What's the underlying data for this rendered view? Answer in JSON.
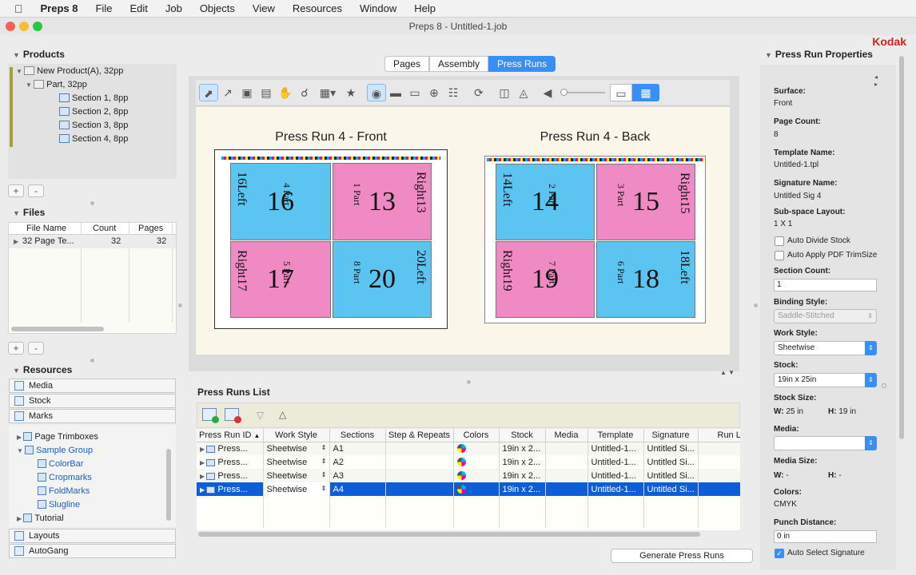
{
  "menubar": {
    "apple_icon": "apple-icon",
    "app": "Preps 8",
    "items": [
      "File",
      "Edit",
      "Job",
      "Objects",
      "View",
      "Resources",
      "Window",
      "Help"
    ]
  },
  "window": {
    "title": "Preps 8 - Untitled-1.job",
    "brand": "Kodak"
  },
  "products": {
    "title": "Products",
    "items": [
      "New Product(A), 32pp",
      "Part, 32pp",
      "Section 1, 8pp",
      "Section 2, 8pp",
      "Section 3, 8pp",
      "Section 4, 8pp"
    ],
    "add": "+",
    "remove": "-"
  },
  "files": {
    "title": "Files",
    "columns": [
      "File Name",
      "Count",
      "Pages"
    ],
    "row": {
      "name": "32 Page Te...",
      "count": "32",
      "pages": "32"
    },
    "add": "+",
    "remove": "-"
  },
  "resources": {
    "title": "Resources",
    "top": [
      "Media",
      "Stock",
      "Marks"
    ],
    "tree": [
      "Page Trimboxes",
      "Sample Group",
      "ColorBar",
      "Cropmarks",
      "FoldMarks",
      "Slugline",
      "Tutorial"
    ],
    "bottom": [
      "Layouts",
      "AutoGang"
    ]
  },
  "tabs": [
    "Pages",
    "Assembly",
    "Press Runs"
  ],
  "active_tab": "Press Runs",
  "sheets": {
    "front": {
      "title": "Press Run 4 - Front",
      "pages": [
        {
          "num": "16",
          "label": "16Left",
          "part": "4 Part",
          "color": "blue"
        },
        {
          "num": "13",
          "label": "Right13",
          "part": "1 Part",
          "color": "pink"
        },
        {
          "num": "17",
          "label": "Right17",
          "part": "5 Part",
          "color": "pink"
        },
        {
          "num": "20",
          "label": "20Left",
          "part": "8 Part",
          "color": "blue"
        }
      ]
    },
    "back": {
      "title": "Press Run 4 - Back",
      "pages": [
        {
          "num": "14",
          "label": "14Left",
          "part": "2 Part",
          "color": "blue"
        },
        {
          "num": "15",
          "label": "Right15",
          "part": "3 Part",
          "color": "pink"
        },
        {
          "num": "19",
          "label": "Right19",
          "part": "7 Part",
          "color": "pink"
        },
        {
          "num": "18",
          "label": "18Left",
          "part": "6 Part",
          "color": "blue"
        }
      ]
    }
  },
  "press_runs": {
    "title": "Press Runs List",
    "columns": [
      "Press Run ID",
      "Work Style",
      "Sections",
      "Step & Repeats",
      "Colors",
      "Stock",
      "Media",
      "Template",
      "Signature",
      "Run L"
    ],
    "rows": [
      {
        "id": "Press...",
        "work": "Sheetwise",
        "sections": "A1",
        "stock": "19in x 2...",
        "template": "Untitled-1...",
        "signature": "Untitled Si..."
      },
      {
        "id": "Press...",
        "work": "Sheetwise",
        "sections": "A2",
        "stock": "19in x 2...",
        "template": "Untitled-1...",
        "signature": "Untitled Si..."
      },
      {
        "id": "Press...",
        "work": "Sheetwise",
        "sections": "A3",
        "stock": "19in x 2...",
        "template": "Untitled-1...",
        "signature": "Untitled Si..."
      },
      {
        "id": "Press...",
        "work": "Sheetwise",
        "sections": "A4",
        "stock": "19in x 2...",
        "template": "Untitled-1...",
        "signature": "Untitled Si..."
      }
    ],
    "selected_row": 4,
    "generate": "Generate Press Runs"
  },
  "properties": {
    "title": "Press Run Properties",
    "surface_label": "Surface:",
    "surface": "Front",
    "page_count_label": "Page Count:",
    "page_count": "8",
    "template_label": "Template Name:",
    "template": "Untitled-1.tpl",
    "signature_label": "Signature Name:",
    "signature": "Untitled Sig 4",
    "subspace_label": "Sub-space Layout:",
    "subspace": "1 X 1",
    "auto_divide": "Auto Divide Stock",
    "auto_pdf": "Auto Apply PDF TrimSize",
    "section_count_label": "Section Count:",
    "section_count": "1",
    "binding_label": "Binding Style:",
    "binding": "Saddle-Stitched",
    "work_style_label": "Work Style:",
    "work_style": "Sheetwise",
    "stock_label": "Stock:",
    "stock": "19in x 25in",
    "stock_size_label": "Stock Size:",
    "w_label": "W:",
    "stock_w": "25 in",
    "h_label": "H:",
    "stock_h": "19 in",
    "media_label": "Media:",
    "media": "",
    "media_size_label": "Media Size:",
    "media_w": "-",
    "media_h": "-",
    "colors_label": "Colors:",
    "colors": "CMYK",
    "punch_label": "Punch Distance:",
    "punch": "0 in",
    "auto_select": "Auto Select Signature"
  }
}
